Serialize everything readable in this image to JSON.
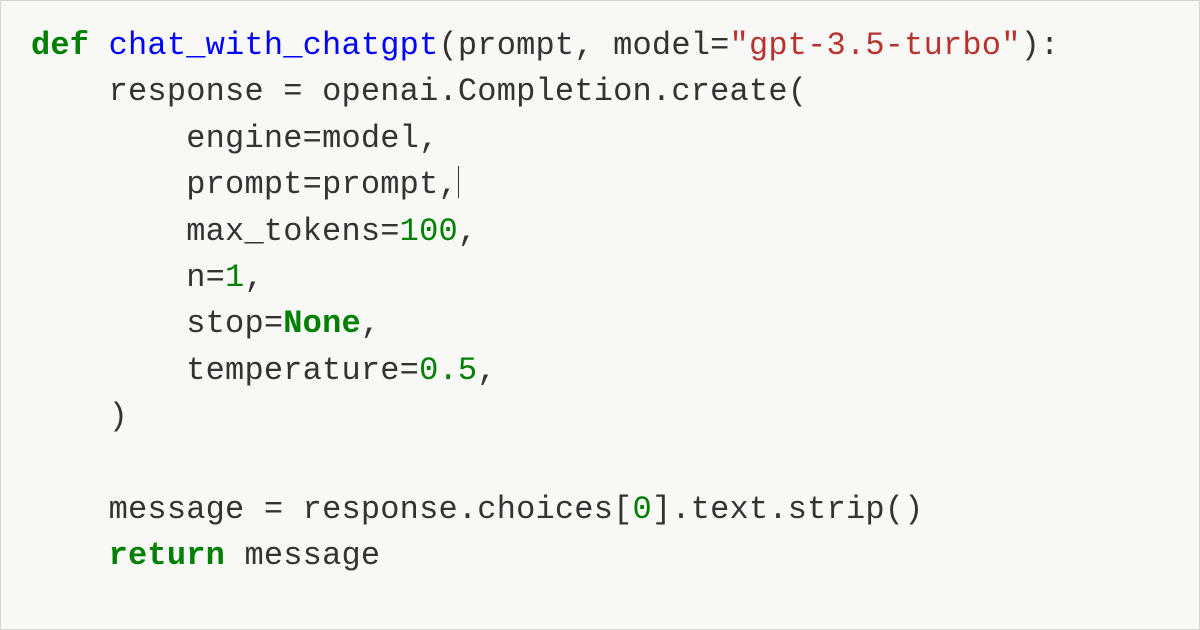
{
  "code": {
    "l1": {
      "kw_def": "def",
      "fn_name": "chat_with_chatgpt",
      "open_paren": "(",
      "p1": "prompt",
      "comma1": ", ",
      "p2": "model",
      "eq": "=",
      "default_str": "\"gpt-3.5-turbo\"",
      "close_paren": ")",
      "colon": ":"
    },
    "l2": {
      "indent": "    ",
      "lhs": "response ",
      "eq": "=",
      "rhs": " openai.Completion.create("
    },
    "l3": {
      "indent": "        ",
      "name": "engine",
      "eq": "=",
      "val": "model",
      "comma": ","
    },
    "l4": {
      "indent": "        ",
      "name": "prompt",
      "eq": "=",
      "val": "prompt",
      "comma": ","
    },
    "l5": {
      "indent": "        ",
      "name": "max_tokens",
      "eq": "=",
      "val": "100",
      "comma": ","
    },
    "l6": {
      "indent": "        ",
      "name": "n",
      "eq": "=",
      "val": "1",
      "comma": ","
    },
    "l7": {
      "indent": "        ",
      "name": "stop",
      "eq": "=",
      "val": "None",
      "comma": ","
    },
    "l8": {
      "indent": "        ",
      "name": "temperature",
      "eq": "=",
      "val": "0.5",
      "comma": ","
    },
    "l9": {
      "indent": "    ",
      "paren": ")"
    },
    "l10": {
      "blank": ""
    },
    "l11": {
      "indent": "    ",
      "lhs": "message ",
      "eq": "=",
      "rhs": " response.choices[",
      "idx": "0",
      "tail": "].text.strip()"
    },
    "l12": {
      "indent": "    ",
      "kw": "return",
      "sp": " ",
      "expr": "message"
    }
  }
}
